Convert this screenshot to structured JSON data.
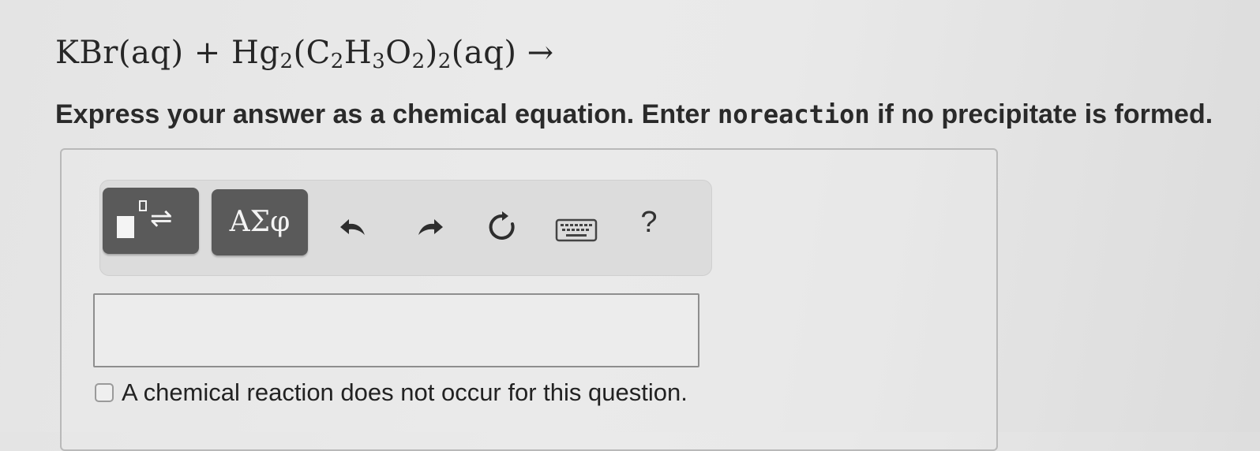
{
  "question": {
    "equation": {
      "reactant1": "KBr(aq)",
      "plus": "+",
      "hg": "Hg",
      "hg_sub": "2",
      "open_paren": "(C",
      "c_sub": "2",
      "h": "H",
      "h_sub": "3",
      "o": "O",
      "o_sub": "2",
      "close_paren": ")",
      "group_sub": "2",
      "state": "(aq)",
      "arrow": "→"
    },
    "instruction_before": "Express your answer as a chemical equation. Enter ",
    "instruction_code": "noreaction",
    "instruction_after": " if no precipitate is formed."
  },
  "toolbar": {
    "templates_icon": "templates-arrows-icon",
    "templates_arrows": "⇌",
    "greek_label": "ΑΣφ",
    "undo_icon": "undo-icon",
    "redo_icon": "redo-icon",
    "reset_icon": "reset-icon",
    "keyboard_icon": "keyboard-icon",
    "help_label": "?"
  },
  "answer": {
    "value": "",
    "no_reaction_checkbox_label": "A chemical reaction does not occur for this question.",
    "no_reaction_checked": false
  },
  "colors": {
    "button_dark": "#5a5a5a",
    "toolbar_bg": "#dcdcdc",
    "text": "#222222"
  }
}
